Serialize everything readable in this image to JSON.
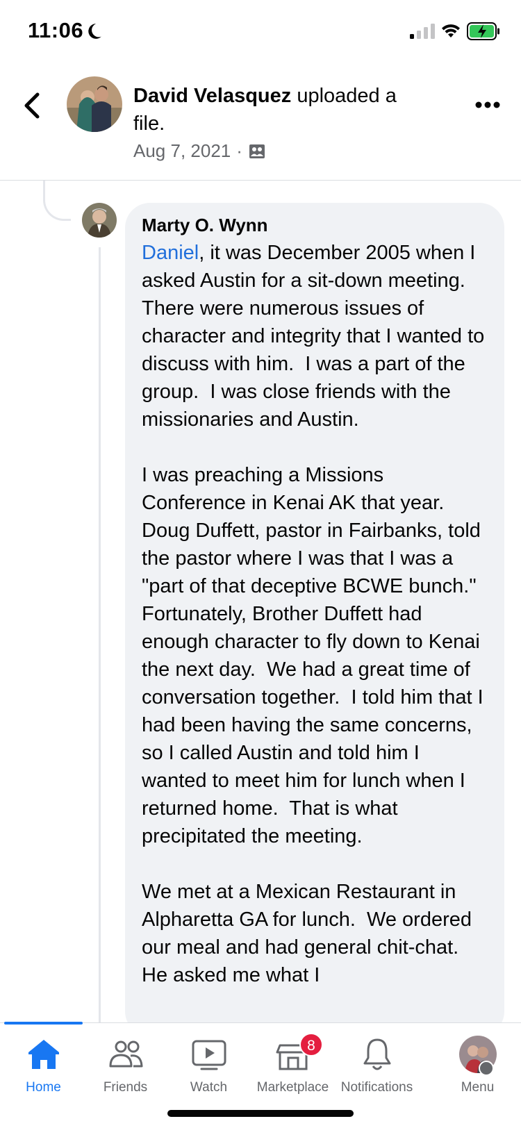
{
  "status": {
    "time": "11:06",
    "icons": [
      "moon-icon",
      "cell-signal-icon",
      "wifi-icon",
      "battery-charging-icon"
    ]
  },
  "header": {
    "author": "David Velasquez",
    "action": " uploaded a file.",
    "date": "Aug 7, 2021",
    "separator": "·",
    "audience_icon": "group-icon"
  },
  "comment": {
    "author": "Marty O. Wynn",
    "mention": "Daniel",
    "text": ", it was December 2005 when I asked Austin for a sit-down meeting.  There were numerous issues of character and integrity that I wanted to discuss with him.  I was a part of the group.  I was close friends with the missionaries and Austin.\n\nI was preaching a Missions Conference in Kenai AK that year.  Doug Duffett, pastor in Fairbanks, told the pastor where I was that I was a \"part of that deceptive BCWE bunch.\"  Fortunately, Brother Duffett had enough character to fly down to Kenai the next day.  We had a great time of conversation together.  I told him that I had been having the same concerns, so I called Austin and told him I wanted to meet him for lunch when I returned home.  That is what precipitated the meeting.\n\nWe met at a Mexican Restaurant in Alpharetta GA for lunch.  We ordered our meal and had general chit-chat.  He asked me what I"
  },
  "tabs": [
    {
      "label": "Home",
      "icon": "home-icon",
      "active": true
    },
    {
      "label": "Friends",
      "icon": "friends-icon"
    },
    {
      "label": "Watch",
      "icon": "watch-icon"
    },
    {
      "label": "Marketplace",
      "icon": "marketplace-icon",
      "badge": "8"
    },
    {
      "label": "Notifications",
      "icon": "bell-icon"
    },
    {
      "label": "Menu",
      "icon": "menu-avatar"
    }
  ],
  "colors": {
    "accent": "#1877f2",
    "mention": "#216fdb",
    "badge": "#e41e3f",
    "bubble": "#f0f2f5"
  }
}
